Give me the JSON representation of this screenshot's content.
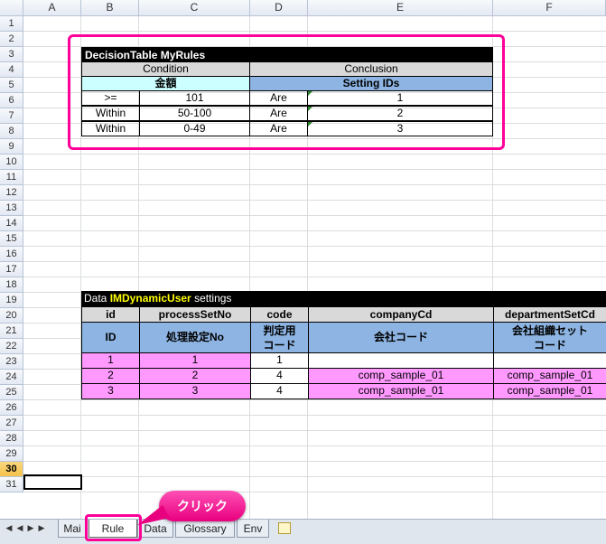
{
  "columns": [
    "A",
    "B",
    "C",
    "D",
    "E",
    "F"
  ],
  "rows": [
    "1",
    "2",
    "3",
    "4",
    "5",
    "6",
    "7",
    "8",
    "9",
    "10",
    "11",
    "12",
    "13",
    "14",
    "15",
    "16",
    "17",
    "18",
    "19",
    "20",
    "21",
    "22",
    "23",
    "24",
    "25",
    "26",
    "27",
    "28",
    "29",
    "30",
    "31"
  ],
  "decision_table": {
    "title": "DecisionTable MyRules",
    "condition_label": "Condition",
    "conclusion_label": "Conclusion",
    "amount_label": "金額",
    "setting_ids_label": "Setting IDs",
    "rows": [
      {
        "op": ">=",
        "value": "101",
        "verb": "Are",
        "id": "1"
      },
      {
        "op": "Within",
        "value": "50-100",
        "verb": "Are",
        "id": "2"
      },
      {
        "op": "Within",
        "value": "0-49",
        "verb": "Are",
        "id": "3"
      }
    ]
  },
  "data_table": {
    "title_prefix": "Data ",
    "title_name": "IMDynamicUser",
    "title_suffix": " settings",
    "headers": [
      "id",
      "processSetNo",
      "code",
      "companyCd",
      "departmentSetCd"
    ],
    "sub_headers": [
      "ID",
      "処理設定No",
      "判定用\nコード",
      "会社コード",
      "会社組織セット\nコード"
    ],
    "rows": [
      [
        "1",
        "1",
        "1",
        "",
        ""
      ],
      [
        "2",
        "2",
        "4",
        "comp_sample_01",
        "comp_sample_01"
      ],
      [
        "3",
        "3",
        "4",
        "comp_sample_01",
        "comp_sample_01"
      ]
    ]
  },
  "sheet_tabs": [
    "Mai",
    "Rule",
    "Data",
    "Glossary",
    "Env"
  ],
  "active_tab": "Rule",
  "callout_text": "クリック",
  "colors": {
    "highlight": "#ff0099",
    "condition_bg": "#ccffff",
    "conclusion_bg": "#8db4e2",
    "title_bg": "#000000",
    "data_key_color": "#ffff00",
    "pink_cell": "#ff99ff",
    "header_gray": "#d9d9d9"
  }
}
